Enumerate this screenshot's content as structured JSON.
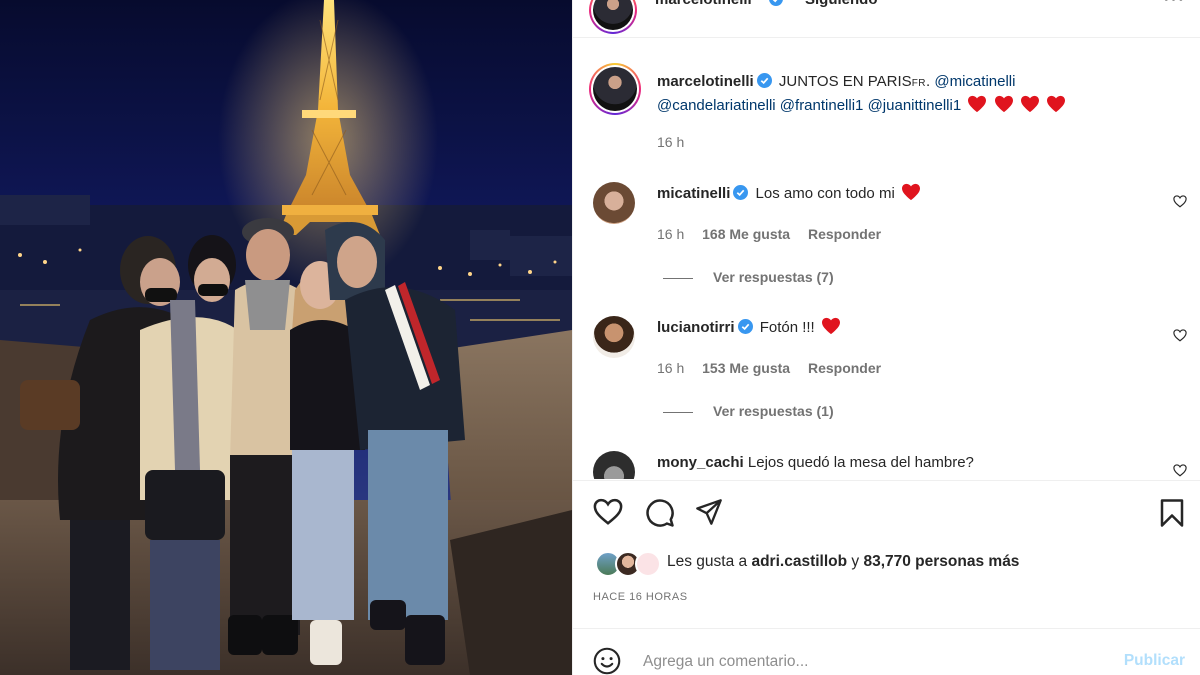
{
  "post": {
    "author": "marcelotinelli",
    "follow_status": "Siguiendo",
    "separator": "•",
    "more": "•••"
  },
  "caption": {
    "author": "marcelotinelli",
    "text": "JUNTOS EN PARIS",
    "flag": "FR",
    "mentions": [
      "@micatinelli",
      "@candelariatinelli",
      "@frantinelli1",
      "@juanittinelli1"
    ],
    "time": "16 h"
  },
  "comments": [
    {
      "user": "micatinelli",
      "text": "Los amo con todo mi",
      "time": "16 h",
      "likes": "168 Me gusta",
      "reply": "Responder",
      "replies": "Ver respuestas (7)"
    },
    {
      "user": "lucianotirri",
      "text": "Fotón !!!",
      "time": "16 h",
      "likes": "153 Me gusta",
      "reply": "Responder",
      "replies": "Ver respuestas (1)"
    },
    {
      "user": "mony_cachi",
      "text": "Lejos quedó la mesa del hambre?"
    }
  ],
  "likes": {
    "prefix": "Les gusta a",
    "user": "adri.castillob",
    "connector": "y",
    "count": "83,770 personas más"
  },
  "timestamp": "HACE 16 HORAS",
  "add_comment": {
    "placeholder": "Agrega un comentario...",
    "publish": "Publicar"
  },
  "colors": {
    "accent": "#0095f6",
    "mention": "#00376b",
    "heart": "#ed4956",
    "muted": "#737373",
    "publish_disabled": "#b2dffc"
  },
  "icons": [
    "verified-icon",
    "heart-icon",
    "comment-icon",
    "share-icon",
    "bookmark-icon",
    "emoji-icon",
    "more-icon"
  ]
}
